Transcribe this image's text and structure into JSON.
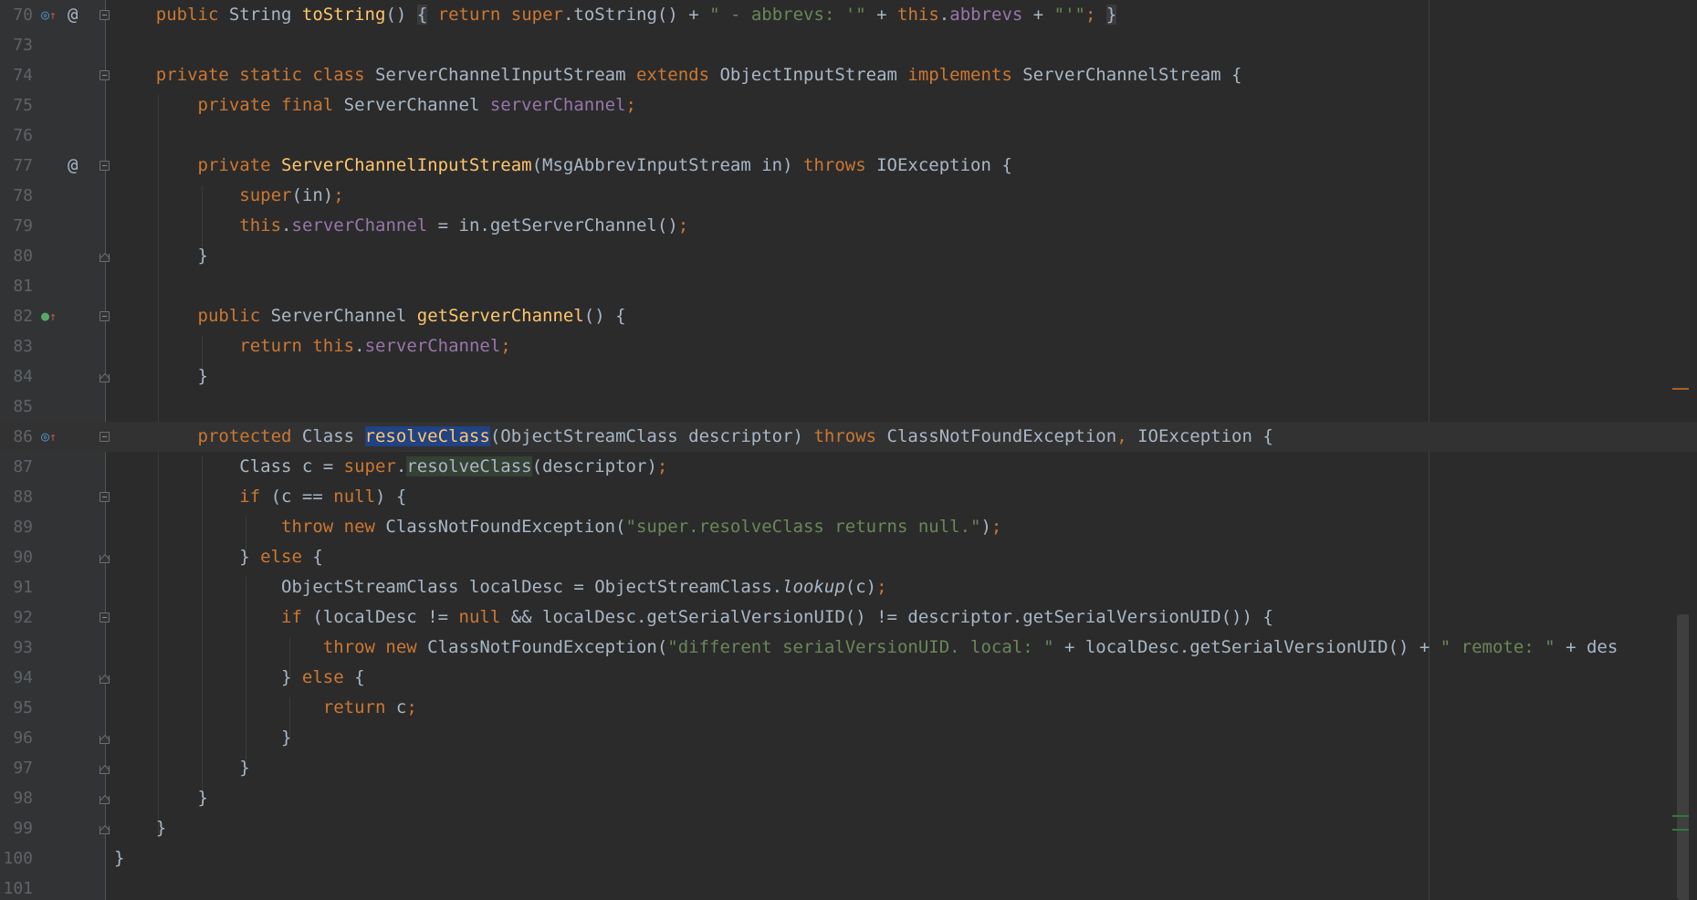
{
  "editor": {
    "lines": [
      {
        "num": "70",
        "icons": [
          "overrides-icon",
          "at-icon"
        ],
        "fold": "start",
        "current": false,
        "tokens": [
          {
            "t": "    "
          },
          {
            "t": "public ",
            "c": "kw"
          },
          {
            "t": "String "
          },
          {
            "t": "toString",
            "c": "fn"
          },
          {
            "t": "() "
          },
          {
            "t": "{",
            "c": "fold-box"
          },
          {
            "t": " "
          },
          {
            "t": "return ",
            "c": "kw"
          },
          {
            "t": "super",
            "c": "kw"
          },
          {
            "t": ".toString() + "
          },
          {
            "t": "\" - abbrevs: '\"",
            "c": "str"
          },
          {
            "t": " + "
          },
          {
            "t": "this",
            "c": "kw"
          },
          {
            "t": "."
          },
          {
            "t": "abbrevs",
            "c": "fld"
          },
          {
            "t": " + "
          },
          {
            "t": "\"'\"",
            "c": "str"
          },
          {
            "t": ";",
            "c": "kw"
          },
          {
            "t": " "
          },
          {
            "t": "}",
            "c": "fold-box"
          }
        ]
      },
      {
        "num": "73",
        "icons": [],
        "fold": "",
        "current": false,
        "tokens": []
      },
      {
        "num": "74",
        "icons": [],
        "fold": "start",
        "current": false,
        "tokens": [
          {
            "t": "    "
          },
          {
            "t": "private static class ",
            "c": "kw"
          },
          {
            "t": "ServerChannelInputStream "
          },
          {
            "t": "extends ",
            "c": "kw"
          },
          {
            "t": "ObjectInputStream "
          },
          {
            "t": "implements ",
            "c": "kw"
          },
          {
            "t": "ServerChannelStream {"
          }
        ]
      },
      {
        "num": "75",
        "icons": [],
        "fold": "",
        "current": false,
        "tokens": [
          {
            "t": "        "
          },
          {
            "t": "private final ",
            "c": "kw"
          },
          {
            "t": "ServerChannel "
          },
          {
            "t": "serverChannel",
            "c": "fld"
          },
          {
            "t": ";",
            "c": "kw"
          }
        ]
      },
      {
        "num": "76",
        "icons": [],
        "fold": "",
        "current": false,
        "tokens": []
      },
      {
        "num": "77",
        "icons": [
          "",
          "at-icon"
        ],
        "fold": "start",
        "current": false,
        "tokens": [
          {
            "t": "        "
          },
          {
            "t": "private ",
            "c": "kw"
          },
          {
            "t": "ServerChannelInputStream",
            "c": "fn"
          },
          {
            "t": "(MsgAbbrevInputStream in) "
          },
          {
            "t": "throws ",
            "c": "kw"
          },
          {
            "t": "IOException {"
          }
        ]
      },
      {
        "num": "78",
        "icons": [],
        "fold": "",
        "current": false,
        "tokens": [
          {
            "t": "            "
          },
          {
            "t": "super",
            "c": "kw"
          },
          {
            "t": "(in)"
          },
          {
            "t": ";",
            "c": "kw"
          }
        ]
      },
      {
        "num": "79",
        "icons": [],
        "fold": "",
        "current": false,
        "tokens": [
          {
            "t": "            "
          },
          {
            "t": "this",
            "c": "kw"
          },
          {
            "t": "."
          },
          {
            "t": "serverChannel",
            "c": "fld"
          },
          {
            "t": " = in.getServerChannel()"
          },
          {
            "t": ";",
            "c": "kw"
          }
        ]
      },
      {
        "num": "80",
        "icons": [],
        "fold": "end",
        "current": false,
        "tokens": [
          {
            "t": "        }"
          }
        ]
      },
      {
        "num": "81",
        "icons": [],
        "fold": "",
        "current": false,
        "tokens": []
      },
      {
        "num": "82",
        "icons": [
          "implements-icon"
        ],
        "fold": "start",
        "current": false,
        "tokens": [
          {
            "t": "        "
          },
          {
            "t": "public ",
            "c": "kw"
          },
          {
            "t": "ServerChannel "
          },
          {
            "t": "getServerChannel",
            "c": "fn"
          },
          {
            "t": "() {"
          }
        ]
      },
      {
        "num": "83",
        "icons": [],
        "fold": "",
        "current": false,
        "tokens": [
          {
            "t": "            "
          },
          {
            "t": "return this",
            "c": "kw"
          },
          {
            "t": "."
          },
          {
            "t": "serverChannel",
            "c": "fld"
          },
          {
            "t": ";",
            "c": "kw"
          }
        ]
      },
      {
        "num": "84",
        "icons": [],
        "fold": "end",
        "current": false,
        "tokens": [
          {
            "t": "        }"
          }
        ]
      },
      {
        "num": "85",
        "icons": [],
        "fold": "",
        "current": false,
        "tokens": []
      },
      {
        "num": "86",
        "icons": [
          "overrides-icon"
        ],
        "fold": "start",
        "current": true,
        "tokens": [
          {
            "t": "        "
          },
          {
            "t": "protected ",
            "c": "kw"
          },
          {
            "t": "Class "
          },
          {
            "t": "resolveClass",
            "c": "fn sel"
          },
          {
            "t": "(ObjectStreamClass descriptor) "
          },
          {
            "t": "throws ",
            "c": "kw"
          },
          {
            "t": "ClassNotFoundException"
          },
          {
            "t": ", ",
            "c": "kw"
          },
          {
            "t": "IOException {"
          }
        ]
      },
      {
        "num": "87",
        "icons": [],
        "fold": "",
        "current": false,
        "tokens": [
          {
            "t": "            "
          },
          {
            "t": "Class c = "
          },
          {
            "t": "super",
            "c": "kw"
          },
          {
            "t": "."
          },
          {
            "t": "resolveClass",
            "c": "usage"
          },
          {
            "t": "(descriptor)"
          },
          {
            "t": ";",
            "c": "kw"
          }
        ]
      },
      {
        "num": "88",
        "icons": [],
        "fold": "start",
        "current": false,
        "tokens": [
          {
            "t": "            "
          },
          {
            "t": "if ",
            "c": "kw"
          },
          {
            "t": "(c == "
          },
          {
            "t": "null",
            "c": "kw"
          },
          {
            "t": ") {"
          }
        ]
      },
      {
        "num": "89",
        "icons": [],
        "fold": "",
        "current": false,
        "tokens": [
          {
            "t": "                "
          },
          {
            "t": "throw new ",
            "c": "kw"
          },
          {
            "t": "ClassNotFoundException("
          },
          {
            "t": "\"super.resolveClass returns null.\"",
            "c": "str"
          },
          {
            "t": ")"
          },
          {
            "t": ";",
            "c": "kw"
          }
        ]
      },
      {
        "num": "90",
        "icons": [],
        "fold": "end",
        "current": false,
        "tokens": [
          {
            "t": "            } "
          },
          {
            "t": "else ",
            "c": "kw"
          },
          {
            "t": "{"
          }
        ]
      },
      {
        "num": "91",
        "icons": [],
        "fold": "",
        "current": false,
        "tokens": [
          {
            "t": "                "
          },
          {
            "t": "ObjectStreamClass localDesc = ObjectStreamClass."
          },
          {
            "t": "lookup",
            "c": "it"
          },
          {
            "t": "(c)"
          },
          {
            "t": ";",
            "c": "kw"
          }
        ]
      },
      {
        "num": "92",
        "icons": [],
        "fold": "start",
        "current": false,
        "tokens": [
          {
            "t": "                "
          },
          {
            "t": "if ",
            "c": "kw"
          },
          {
            "t": "(localDesc != "
          },
          {
            "t": "null ",
            "c": "kw"
          },
          {
            "t": "&& localDesc.getSerialVersionUID() != descriptor.getSerialVersionUID()) {"
          }
        ]
      },
      {
        "num": "93",
        "icons": [],
        "fold": "",
        "current": false,
        "tokens": [
          {
            "t": "                    "
          },
          {
            "t": "throw new ",
            "c": "kw"
          },
          {
            "t": "ClassNotFoundException("
          },
          {
            "t": "\"different serialVersionUID. local: \"",
            "c": "str"
          },
          {
            "t": " + localDesc.getSerialVersionUID() + "
          },
          {
            "t": "\" remote: \"",
            "c": "str"
          },
          {
            "t": " + des"
          }
        ]
      },
      {
        "num": "94",
        "icons": [],
        "fold": "end",
        "current": false,
        "tokens": [
          {
            "t": "                } "
          },
          {
            "t": "else ",
            "c": "kw"
          },
          {
            "t": "{"
          }
        ]
      },
      {
        "num": "95",
        "icons": [],
        "fold": "",
        "current": false,
        "tokens": [
          {
            "t": "                    "
          },
          {
            "t": "return ",
            "c": "kw"
          },
          {
            "t": "c"
          },
          {
            "t": ";",
            "c": "kw"
          }
        ]
      },
      {
        "num": "96",
        "icons": [],
        "fold": "end",
        "current": false,
        "tokens": [
          {
            "t": "                }"
          }
        ]
      },
      {
        "num": "97",
        "icons": [],
        "fold": "end",
        "current": false,
        "tokens": [
          {
            "t": "            }"
          }
        ]
      },
      {
        "num": "98",
        "icons": [],
        "fold": "end",
        "current": false,
        "tokens": [
          {
            "t": "        }"
          }
        ]
      },
      {
        "num": "99",
        "icons": [],
        "fold": "end",
        "current": false,
        "tokens": [
          {
            "t": "    }"
          }
        ]
      },
      {
        "num": "100",
        "icons": [],
        "fold": "",
        "current": false,
        "tokens": [
          {
            "t": "}"
          }
        ]
      },
      {
        "num": "101",
        "icons": [],
        "fold": "",
        "current": false,
        "tokens": []
      }
    ],
    "colors": {
      "background": "#2b2b2b",
      "gutter": "#313335",
      "keyword": "#cc7832",
      "method": "#ffc66d",
      "field": "#9876aa",
      "string": "#6a8759",
      "text": "#a9b7c6",
      "selection": "#214283",
      "line_number": "#606366"
    }
  }
}
